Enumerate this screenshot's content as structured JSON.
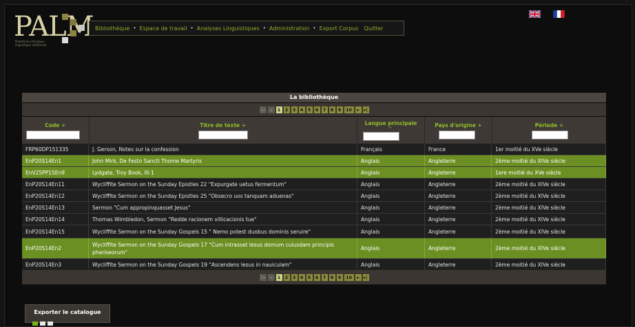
{
  "app": {
    "logo_text": "PALM",
    "logo_subtitle": "Plateforme d'analyse linguistique médiévale"
  },
  "menu": {
    "items": [
      "Bibliothèque",
      "Espace de travail",
      "Analyses Linguistiques",
      "Administration",
      "Export Corpus",
      "Quitter"
    ]
  },
  "flags": [
    "english-flag",
    "french-flag"
  ],
  "library": {
    "title": "La bibliothèque",
    "pages": [
      "1",
      "2",
      "3",
      "4",
      "5",
      "6",
      "7",
      "8",
      "9",
      "10"
    ],
    "current_page": "1",
    "columns": [
      "Code ÷",
      "Titre de texte ÷",
      "Langue principale",
      "Pays d'origine ÷",
      "Période ÷"
    ],
    "sort_glyph_langue": "÷",
    "rows": [
      {
        "code": "FRP60DP151335",
        "title": "J. Gerson, Notes sur la confession",
        "lang": "Français",
        "country": "France",
        "period": "1er moitié du XVe siècle",
        "highlight": false
      },
      {
        "code": "EnP20S14En1",
        "title": "John Mirk, De Festo Sancti Thome Martyris",
        "lang": "Anglais",
        "country": "Angleterre",
        "period": "2ème moitié du XIVe siècle",
        "highlight": true
      },
      {
        "code": "EnV25PP15En9",
        "title": "Lydgate, Troy Book, III-1",
        "lang": "Anglais",
        "country": "Angleterre",
        "period": "1ere moitié du XVe siècle",
        "highlight": true
      },
      {
        "code": "EnP20S14En11",
        "title": "Wycliffite Sermon on the Sunday Epistles 22 \"Expurgate uetus fermentum\"",
        "lang": "Anglais",
        "country": "Angleterre",
        "period": "2ème moitié du XIVe siècle",
        "highlight": false
      },
      {
        "code": "EnP20S14En12",
        "title": "Wycliffite Sermon on the Sunday Epistles 25 \"Obsecro uos tanquam aduenas\"",
        "lang": "Anglais",
        "country": "Angleterre",
        "period": "2ème moitié du XIVe siècle",
        "highlight": false
      },
      {
        "code": "EnP20S14En13",
        "title": "Sermon \"Cum appropinquasset Jesus\"",
        "lang": "Anglais",
        "country": "Angleterre",
        "period": "2ème moitié du XIVe siècle",
        "highlight": false
      },
      {
        "code": "EnP20S14En14",
        "title": "Thomas Wimbledon, Sermon \"Redde racionem villicacionis tue\"",
        "lang": "Anglais",
        "country": "Angleterre",
        "period": "2ème moitié du XIVe siècle",
        "highlight": false
      },
      {
        "code": "EnP20S14En15",
        "title": "Wycliffite Sermon on the Sunday Gospels 15 \" Nemo potest duobus dominis seruire\"",
        "lang": "Anglais",
        "country": "Angleterre",
        "period": "2ème moitié du XIVe siècle",
        "highlight": false
      },
      {
        "code": "EnP20S14En2",
        "title": "Wycliffite Sermon on the Sunday Gospels 17 \"Cum intrasset Iesus domum cuiusdam principis phariseorum\"",
        "lang": "Anglais",
        "country": "Angleterre",
        "period": "2ème moitié du XIVe siècle",
        "highlight": true
      },
      {
        "code": "EnP20S14En3",
        "title": "Wycliffite Sermon on the Sunday Gospels 19 \"Ascendens Iesus in nauiculam\"",
        "lang": "Anglais",
        "country": "Angleterre",
        "period": "2ème moitié du XIVe siècle",
        "highlight": false
      }
    ]
  },
  "export": {
    "title": "Exporter le catalogue",
    "icons": [
      "excel-icon",
      "pdf-icon",
      "document-icon"
    ]
  }
}
